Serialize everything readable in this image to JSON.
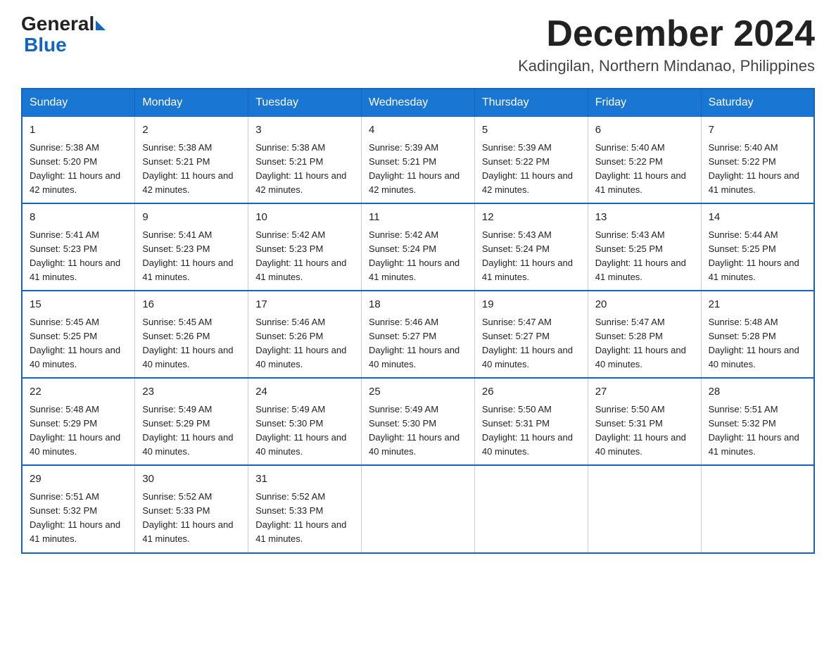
{
  "logo": {
    "general": "General",
    "blue": "Blue"
  },
  "title": {
    "month": "December 2024",
    "location": "Kadingilan, Northern Mindanao, Philippines"
  },
  "headers": [
    "Sunday",
    "Monday",
    "Tuesday",
    "Wednesday",
    "Thursday",
    "Friday",
    "Saturday"
  ],
  "weeks": [
    [
      {
        "day": "1",
        "sunrise": "5:38 AM",
        "sunset": "5:20 PM",
        "daylight": "11 hours and 42 minutes."
      },
      {
        "day": "2",
        "sunrise": "5:38 AM",
        "sunset": "5:21 PM",
        "daylight": "11 hours and 42 minutes."
      },
      {
        "day": "3",
        "sunrise": "5:38 AM",
        "sunset": "5:21 PM",
        "daylight": "11 hours and 42 minutes."
      },
      {
        "day": "4",
        "sunrise": "5:39 AM",
        "sunset": "5:21 PM",
        "daylight": "11 hours and 42 minutes."
      },
      {
        "day": "5",
        "sunrise": "5:39 AM",
        "sunset": "5:22 PM",
        "daylight": "11 hours and 42 minutes."
      },
      {
        "day": "6",
        "sunrise": "5:40 AM",
        "sunset": "5:22 PM",
        "daylight": "11 hours and 41 minutes."
      },
      {
        "day": "7",
        "sunrise": "5:40 AM",
        "sunset": "5:22 PM",
        "daylight": "11 hours and 41 minutes."
      }
    ],
    [
      {
        "day": "8",
        "sunrise": "5:41 AM",
        "sunset": "5:23 PM",
        "daylight": "11 hours and 41 minutes."
      },
      {
        "day": "9",
        "sunrise": "5:41 AM",
        "sunset": "5:23 PM",
        "daylight": "11 hours and 41 minutes."
      },
      {
        "day": "10",
        "sunrise": "5:42 AM",
        "sunset": "5:23 PM",
        "daylight": "11 hours and 41 minutes."
      },
      {
        "day": "11",
        "sunrise": "5:42 AM",
        "sunset": "5:24 PM",
        "daylight": "11 hours and 41 minutes."
      },
      {
        "day": "12",
        "sunrise": "5:43 AM",
        "sunset": "5:24 PM",
        "daylight": "11 hours and 41 minutes."
      },
      {
        "day": "13",
        "sunrise": "5:43 AM",
        "sunset": "5:25 PM",
        "daylight": "11 hours and 41 minutes."
      },
      {
        "day": "14",
        "sunrise": "5:44 AM",
        "sunset": "5:25 PM",
        "daylight": "11 hours and 41 minutes."
      }
    ],
    [
      {
        "day": "15",
        "sunrise": "5:45 AM",
        "sunset": "5:25 PM",
        "daylight": "11 hours and 40 minutes."
      },
      {
        "day": "16",
        "sunrise": "5:45 AM",
        "sunset": "5:26 PM",
        "daylight": "11 hours and 40 minutes."
      },
      {
        "day": "17",
        "sunrise": "5:46 AM",
        "sunset": "5:26 PM",
        "daylight": "11 hours and 40 minutes."
      },
      {
        "day": "18",
        "sunrise": "5:46 AM",
        "sunset": "5:27 PM",
        "daylight": "11 hours and 40 minutes."
      },
      {
        "day": "19",
        "sunrise": "5:47 AM",
        "sunset": "5:27 PM",
        "daylight": "11 hours and 40 minutes."
      },
      {
        "day": "20",
        "sunrise": "5:47 AM",
        "sunset": "5:28 PM",
        "daylight": "11 hours and 40 minutes."
      },
      {
        "day": "21",
        "sunrise": "5:48 AM",
        "sunset": "5:28 PM",
        "daylight": "11 hours and 40 minutes."
      }
    ],
    [
      {
        "day": "22",
        "sunrise": "5:48 AM",
        "sunset": "5:29 PM",
        "daylight": "11 hours and 40 minutes."
      },
      {
        "day": "23",
        "sunrise": "5:49 AM",
        "sunset": "5:29 PM",
        "daylight": "11 hours and 40 minutes."
      },
      {
        "day": "24",
        "sunrise": "5:49 AM",
        "sunset": "5:30 PM",
        "daylight": "11 hours and 40 minutes."
      },
      {
        "day": "25",
        "sunrise": "5:49 AM",
        "sunset": "5:30 PM",
        "daylight": "11 hours and 40 minutes."
      },
      {
        "day": "26",
        "sunrise": "5:50 AM",
        "sunset": "5:31 PM",
        "daylight": "11 hours and 40 minutes."
      },
      {
        "day": "27",
        "sunrise": "5:50 AM",
        "sunset": "5:31 PM",
        "daylight": "11 hours and 40 minutes."
      },
      {
        "day": "28",
        "sunrise": "5:51 AM",
        "sunset": "5:32 PM",
        "daylight": "11 hours and 41 minutes."
      }
    ],
    [
      {
        "day": "29",
        "sunrise": "5:51 AM",
        "sunset": "5:32 PM",
        "daylight": "11 hours and 41 minutes."
      },
      {
        "day": "30",
        "sunrise": "5:52 AM",
        "sunset": "5:33 PM",
        "daylight": "11 hours and 41 minutes."
      },
      {
        "day": "31",
        "sunrise": "5:52 AM",
        "sunset": "5:33 PM",
        "daylight": "11 hours and 41 minutes."
      },
      null,
      null,
      null,
      null
    ]
  ],
  "labels": {
    "sunrise": "Sunrise:",
    "sunset": "Sunset:",
    "daylight": "Daylight:"
  }
}
